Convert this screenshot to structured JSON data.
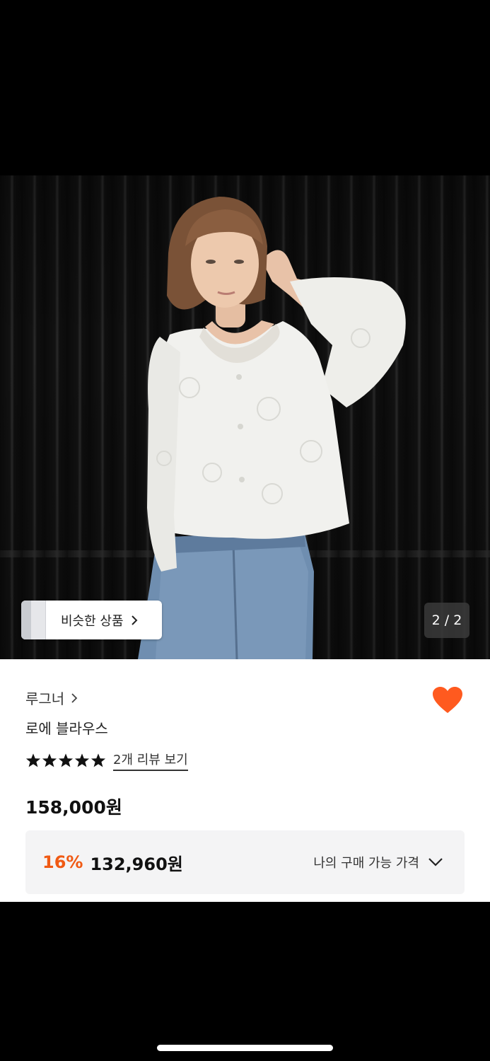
{
  "gallery": {
    "similar_products_label": "비슷한 상품",
    "page_counter": "2 / 2"
  },
  "product": {
    "brand": "루그너",
    "name": "로에 블라우스",
    "rating_stars": 5,
    "review_link": "2개 리뷰 보기",
    "price": "158,000원",
    "discount_percent": "16%",
    "sale_price": "132,960원",
    "my_price_label": "나의 구매 가능 가격"
  },
  "colors": {
    "accent": "#f05a14",
    "heart": "#ff5a1f",
    "price_box_bg": "#f4f4f5"
  },
  "icons": {
    "wishlist": "heart-icon",
    "star": "star-icon",
    "brand_chevron": "chevron-right-icon",
    "expand": "chevron-down-icon"
  }
}
